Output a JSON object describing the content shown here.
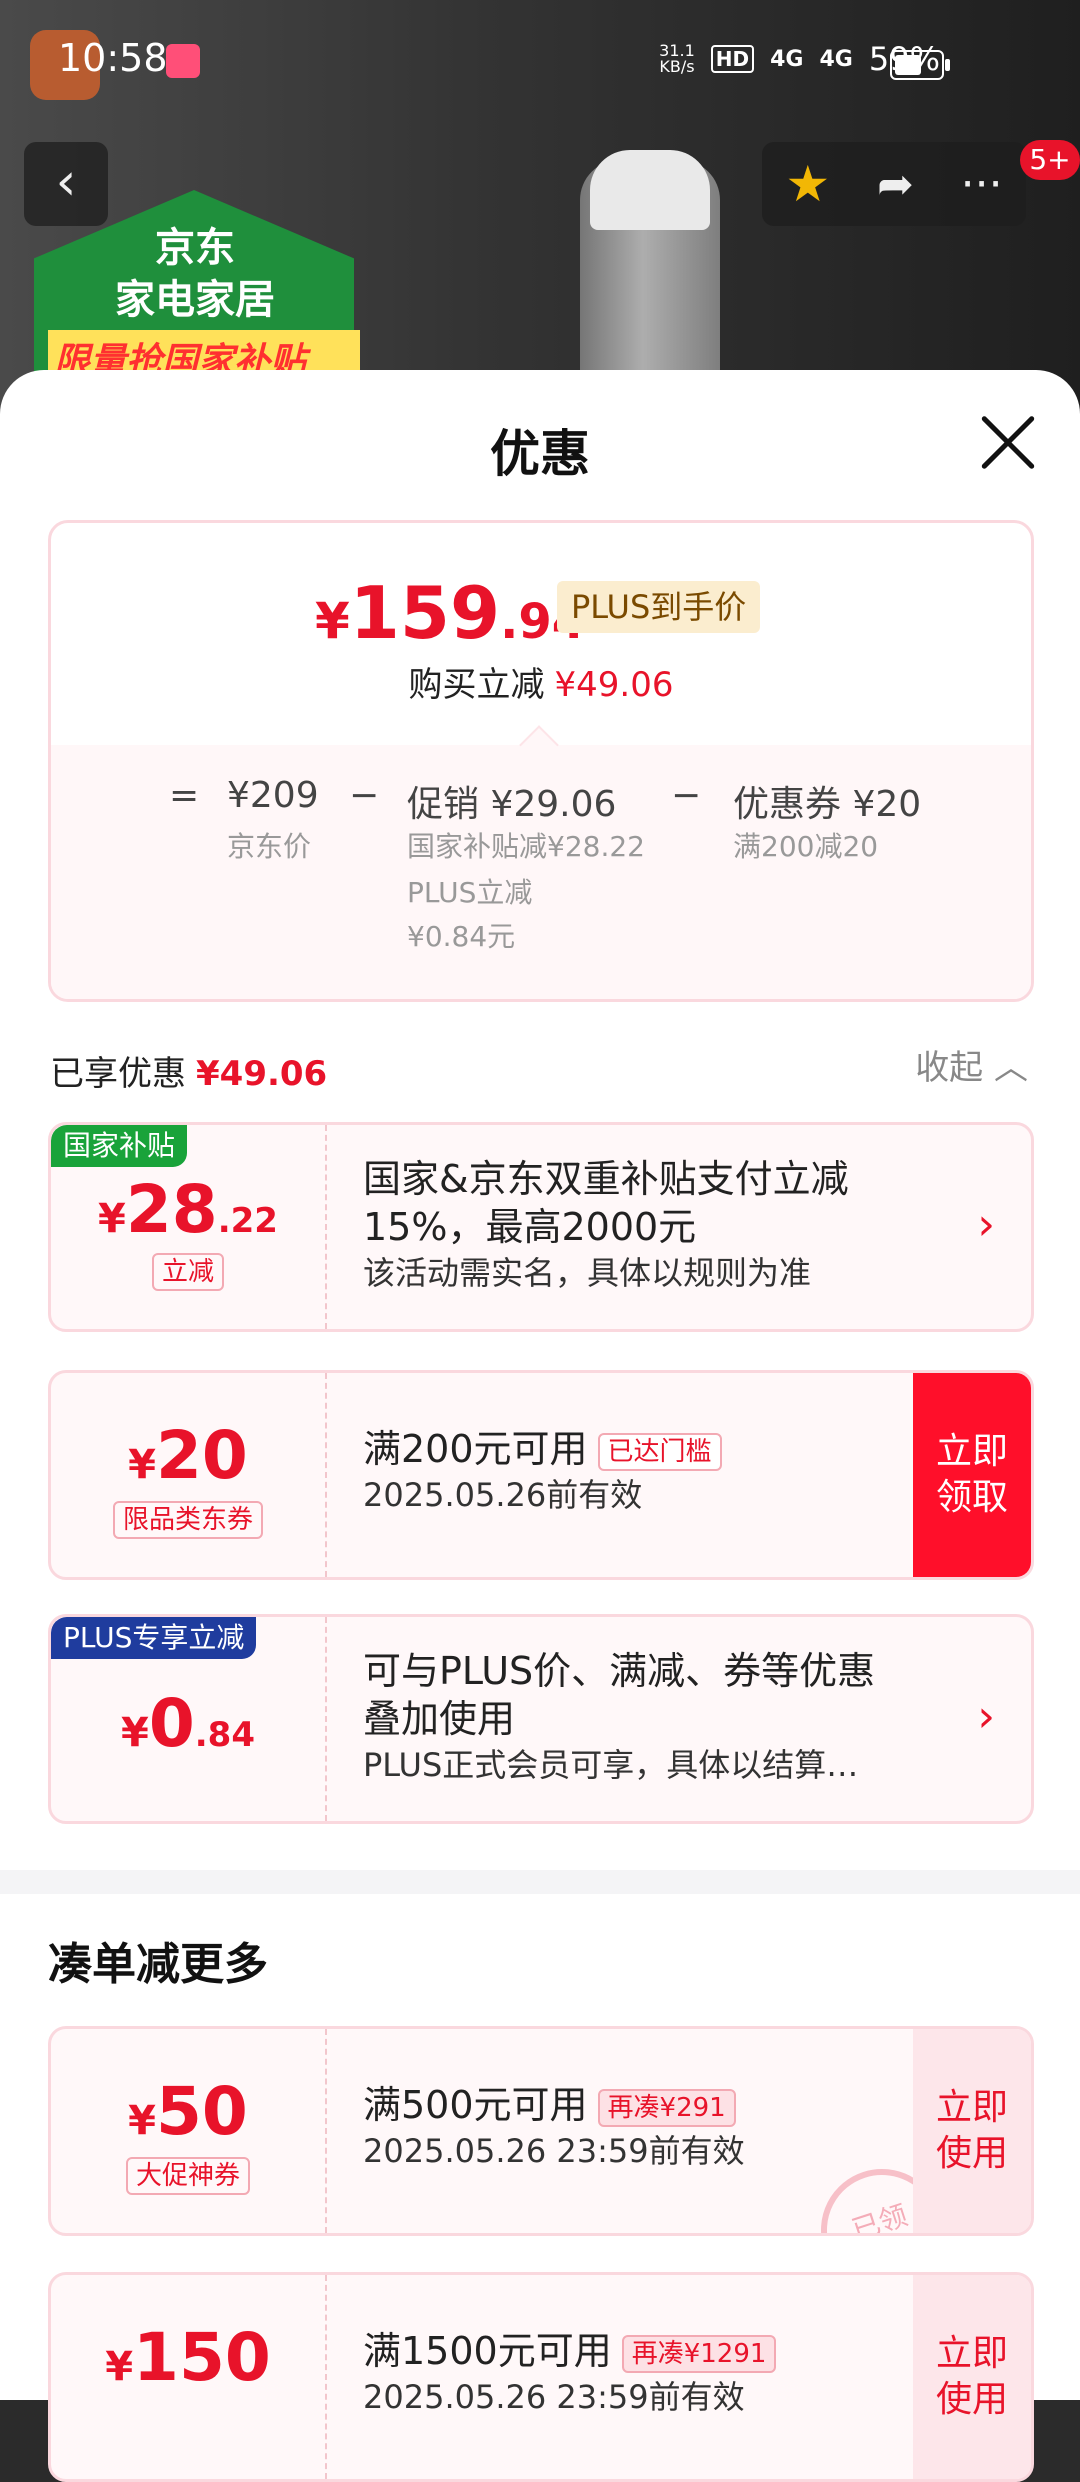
{
  "status_bar": {
    "time": "10:58",
    "net_speed": "31.1",
    "net_unit": "KB/s",
    "hd": "HD",
    "signal1": "4G",
    "signal2": "4G",
    "battery": "59%",
    "battery_level": 0.59
  },
  "background": {
    "house_line1": "京东",
    "house_line2": "家电家居",
    "promo": "限量抢国家补贴"
  },
  "nav": {
    "badge": "5+"
  },
  "sheet": {
    "title": "优惠",
    "price": {
      "symbol": "¥",
      "integer": "159",
      "decimal": ".94",
      "tag": "PLUS到手价",
      "buy_reduce_label": "购买立减",
      "buy_reduce_amount": "¥49.06"
    },
    "calc": {
      "equals": "=",
      "jd_price": "¥209",
      "jd_price_label": "京东价",
      "minus1": "−",
      "promo": "促销 ¥29.06",
      "promo_sub1": "国家补贴减¥28.22",
      "promo_sub2": "PLUS立减",
      "promo_sub3": "¥0.84元",
      "minus2": "−",
      "coupon": "优惠券 ¥20",
      "coupon_sub": "满200减20"
    },
    "enjoyed": {
      "label": "已享优惠",
      "amount": "¥49.06",
      "collapse": "收起 ︿"
    },
    "coupons": [
      {
        "corner": "国家补贴",
        "corner_color": "#19a33a",
        "symbol": "¥",
        "integer": "28",
        "decimal": ".22",
        "tag": "立减",
        "line1": "国家&京东双重补贴支付立减",
        "line2": "15%，最高2000元",
        "sub": "该活动需实名，具体以规则为准"
      },
      {
        "symbol": "¥",
        "integer": "20",
        "tag": "限品类东券",
        "line1": "满200元可用",
        "inline_tag": "已达门槛",
        "sub": "2025.05.26前有效",
        "button": "立即领取"
      },
      {
        "corner": "PLUS专享立减",
        "corner_color": "#1f3c9e",
        "symbol": "¥",
        "integer": "0",
        "decimal": ".84",
        "line1": "可与PLUS价、满减、券等优惠",
        "line2": "叠加使用",
        "sub": "PLUS正式会员可享，具体以结算…"
      }
    ],
    "more_title": "凑单减更多",
    "more_coupons": [
      {
        "symbol": "¥",
        "integer": "50",
        "tag": "大促神券",
        "line1": "满500元可用",
        "inline_tag": "再凑¥291",
        "sub": "2025.05.26 23:59前有效",
        "button": "立即使用",
        "stamp": "已领"
      },
      {
        "symbol": "¥",
        "integer": "150",
        "line1": "满1500元可用",
        "inline_tag": "再凑¥1291",
        "sub": "2025.05.26 23:59前有效",
        "button": "立即使用"
      }
    ]
  }
}
